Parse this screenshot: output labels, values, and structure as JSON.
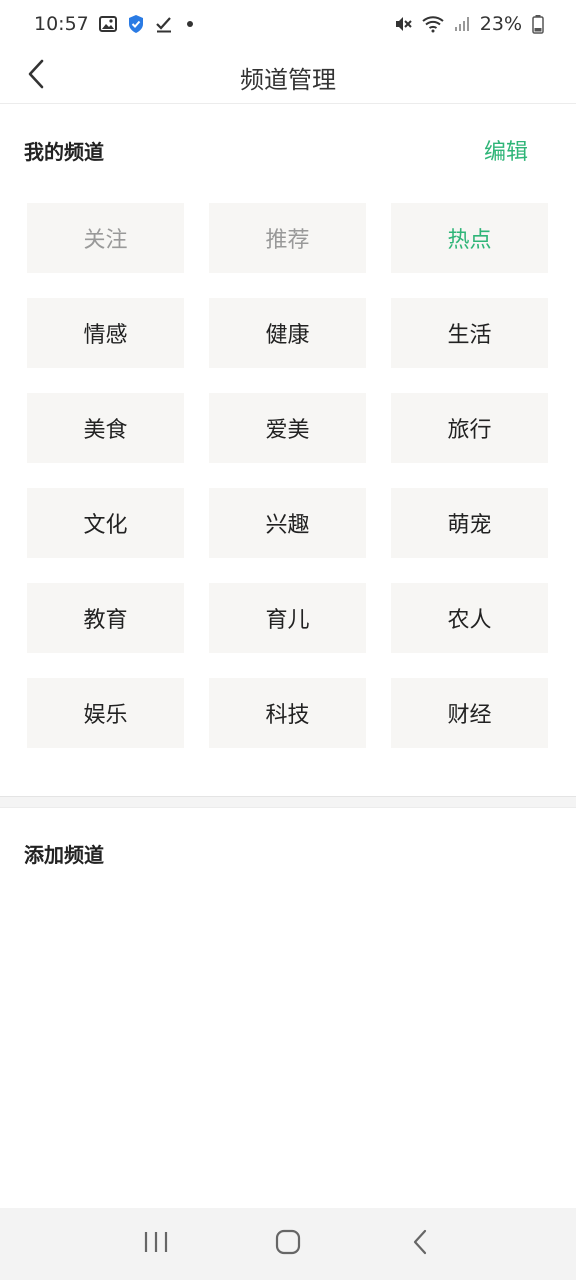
{
  "status_bar": {
    "time": "10:57",
    "battery": "23%",
    "icons": [
      "image-icon",
      "shield-icon",
      "check-icon",
      "dot-icon",
      "mute-icon",
      "wifi-icon",
      "signal-icon",
      "battery-icon"
    ]
  },
  "header": {
    "title": "频道管理",
    "back_icon": "chevron-left-icon"
  },
  "my_channels": {
    "title": "我的频道",
    "edit_label": "编辑",
    "items": [
      {
        "label": "关注",
        "state": "fixed"
      },
      {
        "label": "推荐",
        "state": "fixed"
      },
      {
        "label": "热点",
        "state": "active"
      },
      {
        "label": "情感",
        "state": "normal"
      },
      {
        "label": "健康",
        "state": "normal"
      },
      {
        "label": "生活",
        "state": "normal"
      },
      {
        "label": "美食",
        "state": "normal"
      },
      {
        "label": "爱美",
        "state": "normal"
      },
      {
        "label": "旅行",
        "state": "normal"
      },
      {
        "label": "文化",
        "state": "normal"
      },
      {
        "label": "兴趣",
        "state": "normal"
      },
      {
        "label": "萌宠",
        "state": "normal"
      },
      {
        "label": "教育",
        "state": "normal"
      },
      {
        "label": "育儿",
        "state": "normal"
      },
      {
        "label": "农人",
        "state": "normal"
      },
      {
        "label": "娱乐",
        "state": "normal"
      },
      {
        "label": "科技",
        "state": "normal"
      },
      {
        "label": "财经",
        "state": "normal"
      }
    ]
  },
  "add_channels": {
    "title": "添加频道"
  },
  "colors": {
    "accent": "#2fb578",
    "tile_bg": "#f7f6f4",
    "fixed_text": "#999999"
  },
  "nav_bar": {
    "icons": [
      "recents-icon",
      "home-icon",
      "back-icon"
    ]
  }
}
